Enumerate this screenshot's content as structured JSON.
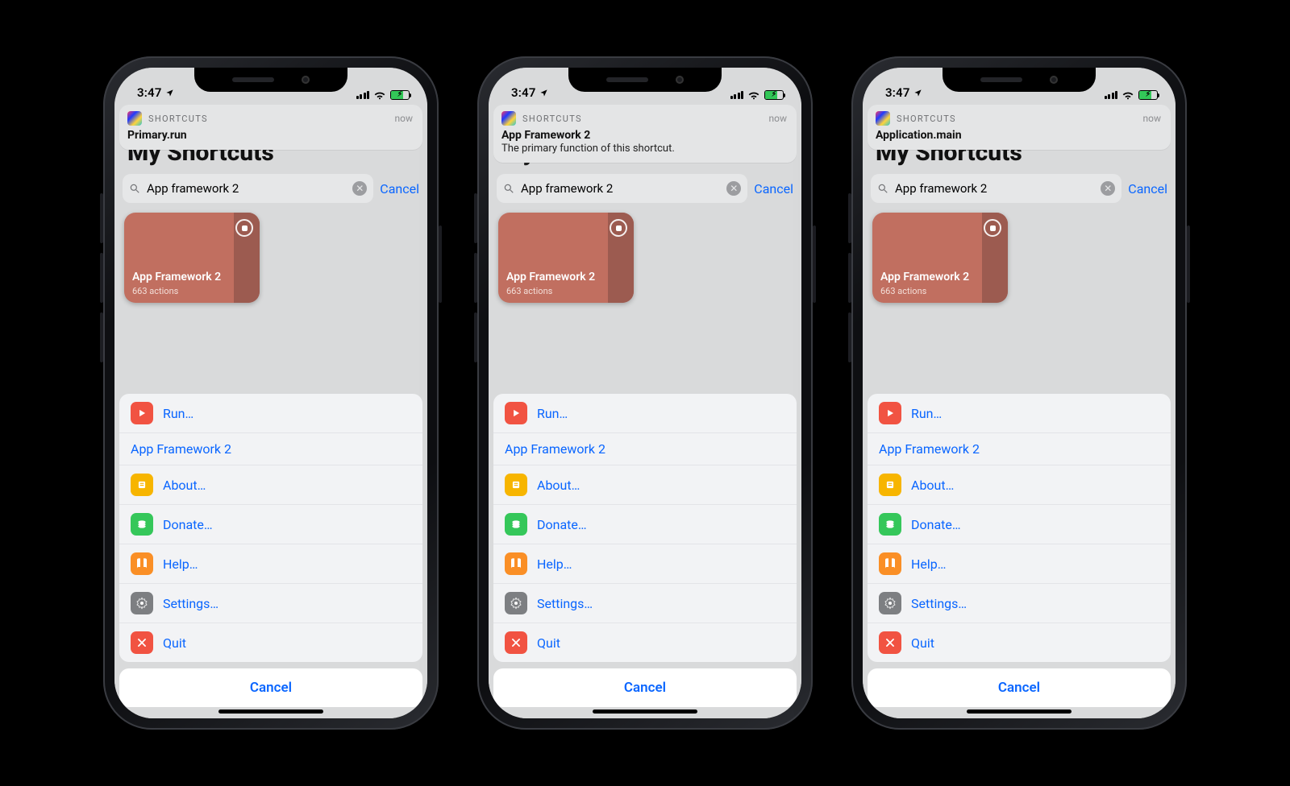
{
  "status": {
    "time": "3:47",
    "location_icon": "◤",
    "battery_charging": true
  },
  "notification": {
    "app": "SHORTCUTS",
    "when": "now"
  },
  "page_title": "My Shortcuts",
  "search": {
    "value": "App framework 2",
    "cancel": "Cancel"
  },
  "tile": {
    "name": "App Framework 2",
    "subtitle": "663 actions"
  },
  "menu": {
    "run": "Run…",
    "header": "App Framework 2",
    "about": "About…",
    "donate": "Donate…",
    "help": "Help…",
    "settings": "Settings…",
    "quit": "Quit",
    "cancel": "Cancel"
  },
  "phones": [
    {
      "notif_title": "Primary.run",
      "notif_body": ""
    },
    {
      "notif_title": "App Framework 2",
      "notif_body": "The primary function of this shortcut."
    },
    {
      "notif_title": "Application.main",
      "notif_body": ""
    }
  ]
}
